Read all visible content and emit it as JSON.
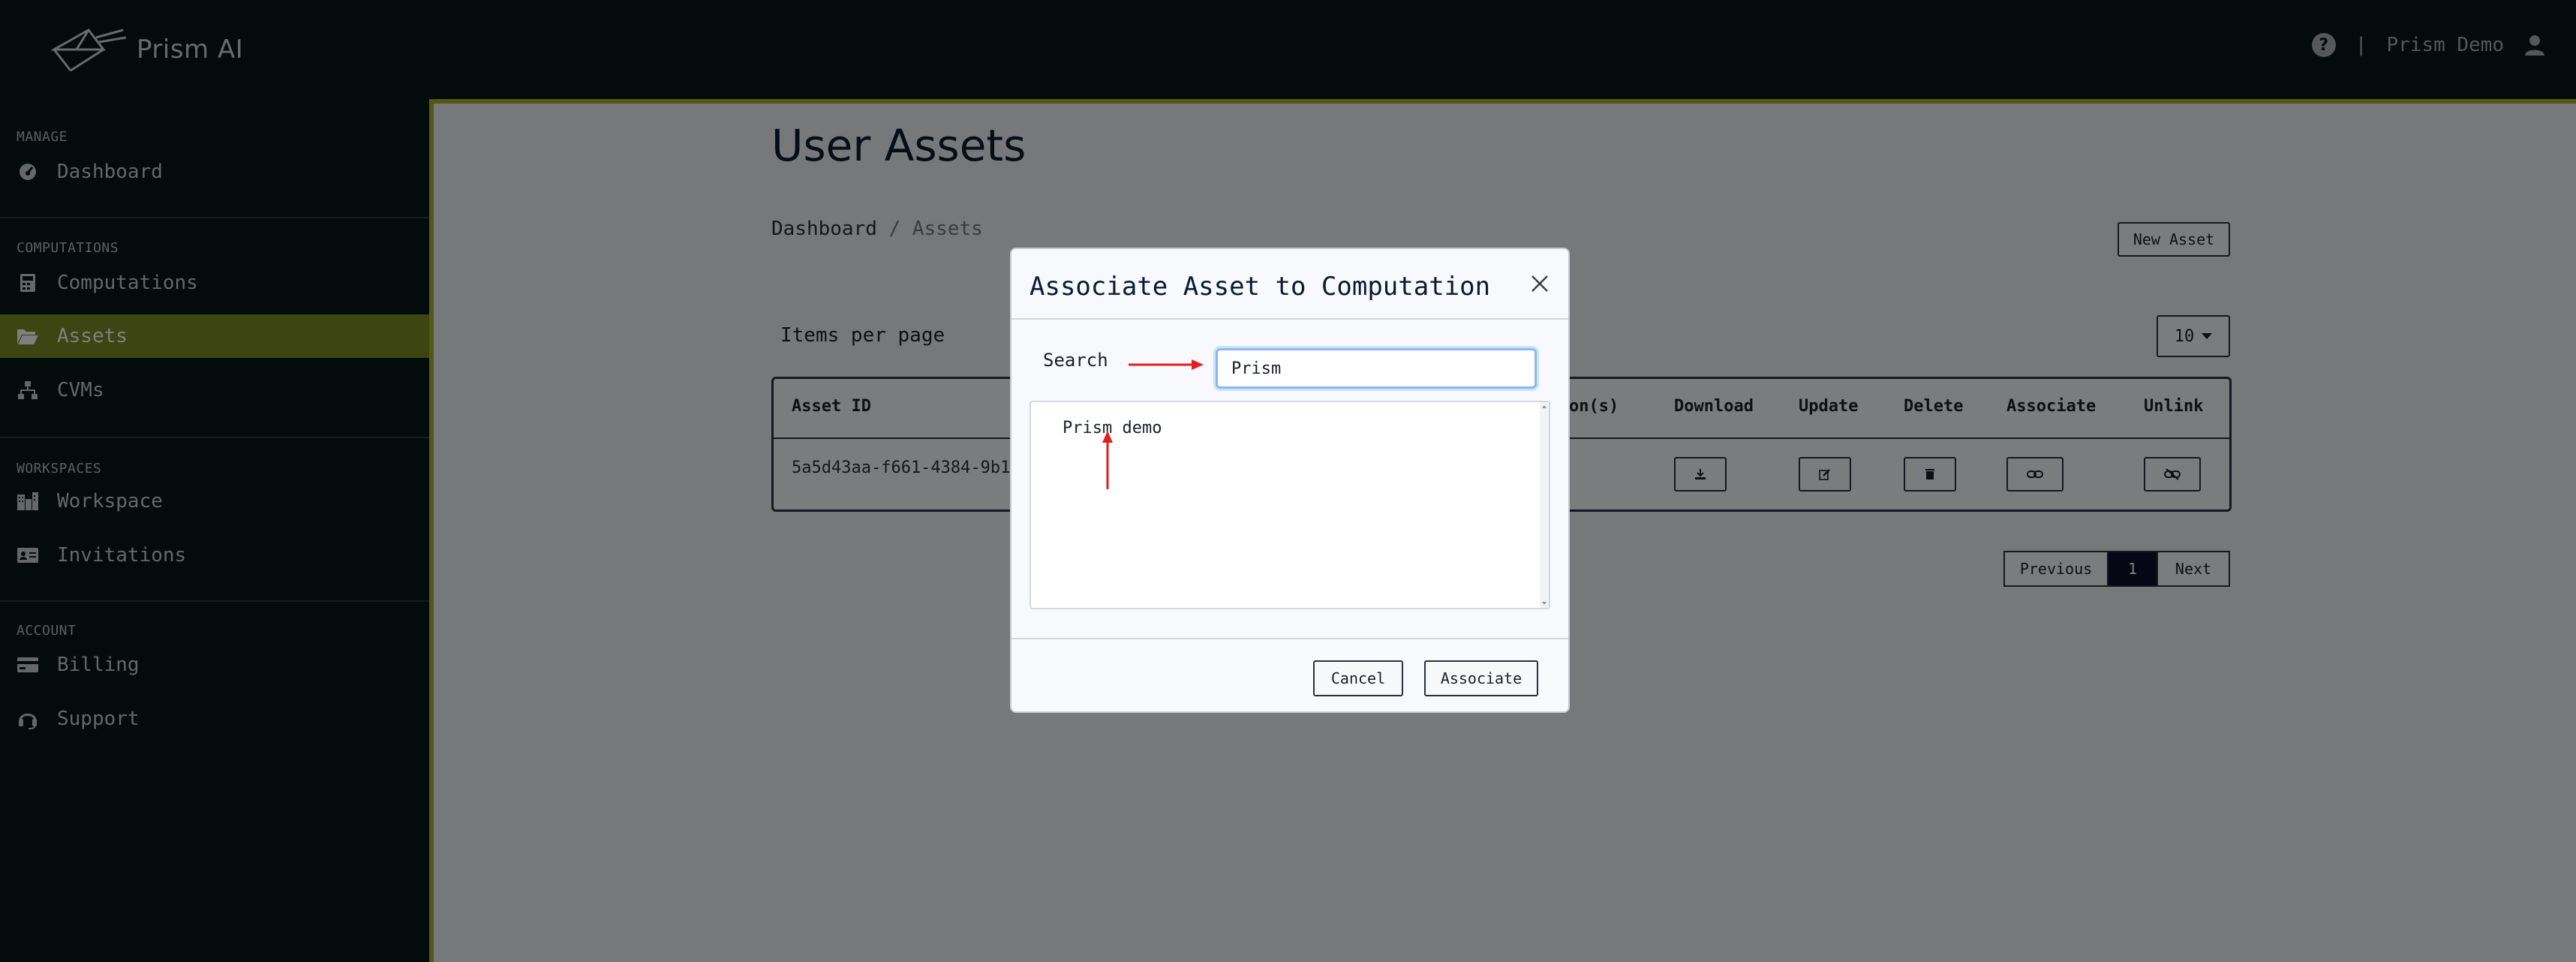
{
  "brand": {
    "name": "Prism AI"
  },
  "header": {
    "separator": "|",
    "user_name": "Prism Demo",
    "help_glyph": "?"
  },
  "sidebar": {
    "manage_title": "MANAGE",
    "computations_title": "COMPUTATIONS",
    "workspaces_title": "WORKSPACES",
    "account_title": "ACCOUNT",
    "items": [
      {
        "label": "Dashboard",
        "icon": "gauge-icon"
      },
      {
        "label": "Computations",
        "icon": "calculator-icon"
      },
      {
        "label": "Assets",
        "icon": "folder-open-icon",
        "active": true
      },
      {
        "label": "CVMs",
        "icon": "sitemap-icon"
      },
      {
        "label": "Workspace",
        "icon": "city-icon"
      },
      {
        "label": "Invitations",
        "icon": "id-card-icon"
      },
      {
        "label": "Billing",
        "icon": "credit-card-icon"
      },
      {
        "label": "Support",
        "icon": "headset-icon"
      }
    ]
  },
  "main": {
    "title": "User Assets",
    "breadcrumb": {
      "home": "Dashboard",
      "sep": "/",
      "current": "Assets"
    },
    "new_asset_label": "New Asset",
    "items_per_page_label": "Items per page",
    "items_per_page_value": "10",
    "table": {
      "columns": [
        "Asset ID",
        "on(s)",
        "Download",
        "Update",
        "Delete",
        "Associate",
        "Unlink"
      ],
      "rows": [
        {
          "asset_id": "5a5d43aa-f661-4384-9b1e"
        }
      ]
    },
    "pagination": {
      "previous": "Previous",
      "current": "1",
      "next": "Next"
    }
  },
  "modal": {
    "title": "Associate Asset to Computation",
    "search_label": "Search",
    "search_value": "Prism",
    "results": [
      "Prism demo"
    ],
    "cancel_label": "Cancel",
    "associate_label": "Associate"
  },
  "colors": {
    "accent": "#a3b22a",
    "active_nav": "#7b8b24",
    "dark_bg": "#071616",
    "annotation": "#e02020"
  }
}
